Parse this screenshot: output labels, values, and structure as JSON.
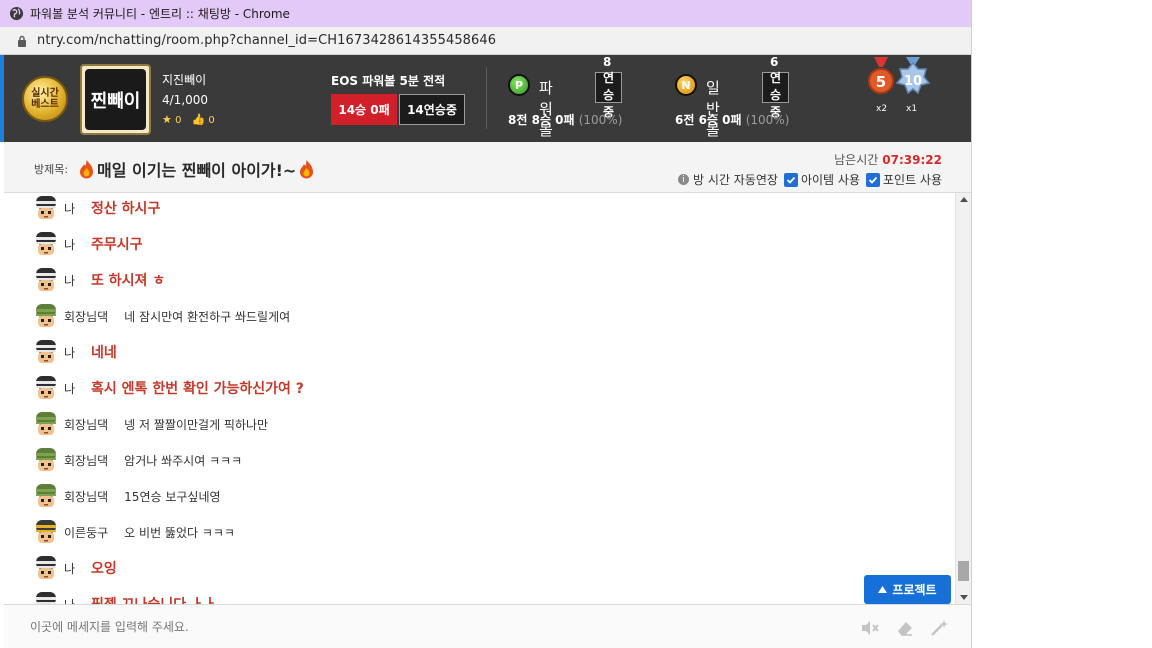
{
  "browser": {
    "title": "파워볼 분석 커뮤니티 - 엔트리 :: 채팅방 - Chrome",
    "url": "ntry.com/nchatting/room.php?channel_id=CH1673428614355458646"
  },
  "room": {
    "best_badge": [
      "실시간",
      "베스트"
    ],
    "avatar_text": "찐빼이",
    "host_name": "지진빼이",
    "members": "4/1,000",
    "stars": "0",
    "likes": "0",
    "eos_title": "EOS 파워볼 5분 전적",
    "eos_record": "14승 0패",
    "eos_streak": "14연승중",
    "powerball": {
      "ball": "P",
      "name": "파워볼",
      "streak": "8연승중",
      "record": "8전 8승 0패",
      "pct": "(100%)"
    },
    "normalball": {
      "ball": "N",
      "name": "일반볼",
      "streak": "6연승중",
      "record": "6전 6승 0패",
      "pct": "(100%)"
    },
    "medals": [
      {
        "label": "5",
        "count": "x2"
      },
      {
        "label": "10",
        "count": "x1"
      }
    ]
  },
  "subject": {
    "label": "방제목:",
    "title": "매일 이기는 찐빼이 아이가!~",
    "remain_label": "남은시간",
    "remain_time": "07:39:22",
    "auto_extend": "방 시간 자동연장",
    "item_use": "아이템 사용",
    "point_use": "포인트 사용"
  },
  "chat": [
    {
      "nick": "나",
      "msg": "정산 하시구",
      "me": true,
      "avatar": "striped"
    },
    {
      "nick": "나",
      "msg": "주무시구",
      "me": true,
      "avatar": "striped"
    },
    {
      "nick": "나",
      "msg": "또 하시져 ㅎ",
      "me": true,
      "avatar": "striped"
    },
    {
      "nick": "회장님댁",
      "msg": "네 잠시만여 환전하구 쏴드릴게여",
      "me": false,
      "avatar": "green"
    },
    {
      "nick": "나",
      "msg": "네네",
      "me": true,
      "avatar": "striped"
    },
    {
      "nick": "나",
      "msg": "혹시 엔톡 한번 확인 가능하신가여 ?",
      "me": true,
      "avatar": "striped"
    },
    {
      "nick": "회장님댁",
      "msg": "넹 저 짤짤이만걸게 픽하나만",
      "me": false,
      "avatar": "green"
    },
    {
      "nick": "회장님댁",
      "msg": "암거나 쏴주시여 ㅋㅋㅋ",
      "me": false,
      "avatar": "green"
    },
    {
      "nick": "회장님댁",
      "msg": "15연승 보구싶네영",
      "me": false,
      "avatar": "green"
    },
    {
      "nick": "이른둥구",
      "msg": "오 비번 뚫었다 ㅋㅋㅋ",
      "me": false,
      "avatar": "yellow"
    },
    {
      "nick": "나",
      "msg": "오잉",
      "me": true,
      "avatar": "striped"
    },
    {
      "nick": "나",
      "msg": "픽젬 끄나습니다 ㅏㅏ",
      "me": true,
      "avatar": "striped"
    }
  ],
  "protect_label": "프로젝트",
  "input": {
    "placeholder": "이곳에 메세지를 입력해 주세요.",
    "value": ""
  }
}
